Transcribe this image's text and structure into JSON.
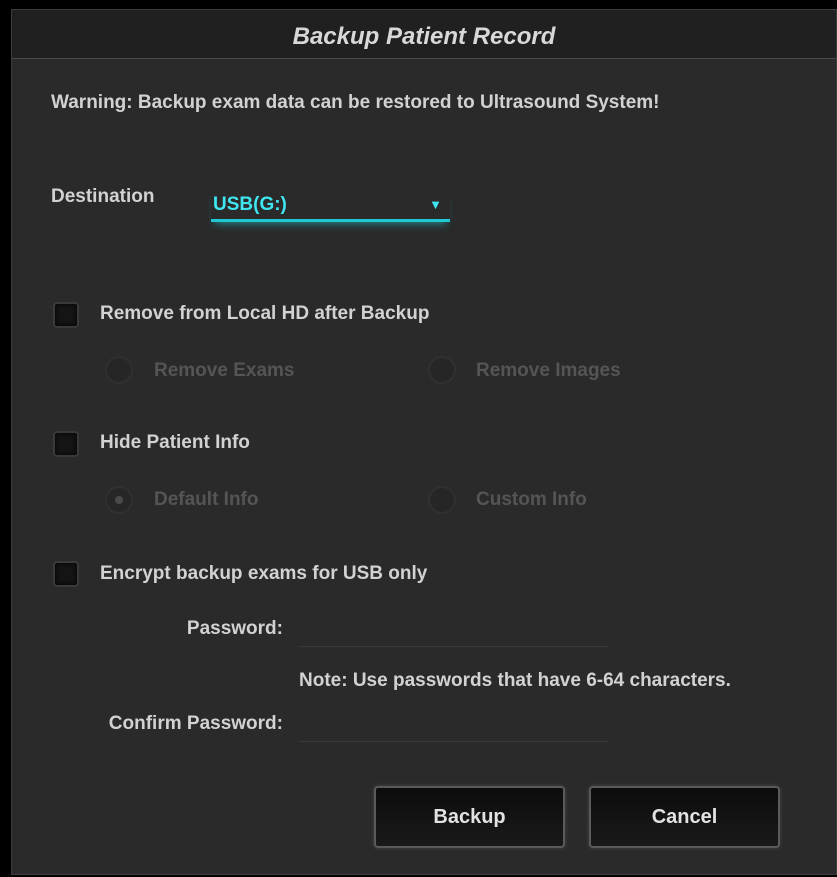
{
  "dialog": {
    "title": "Backup Patient Record",
    "warning": "Warning: Backup exam data can be restored to Ultrasound System!"
  },
  "destination": {
    "label": "Destination",
    "value": "USB(G:)",
    "arrow_glyph": "▼",
    "accent_color": "#3fe6f0"
  },
  "remove_local": {
    "label": "Remove from Local HD after Backup",
    "checked": false,
    "options": [
      {
        "label": "Remove Exams",
        "selected": false,
        "enabled": false
      },
      {
        "label": "Remove Images",
        "selected": false,
        "enabled": false
      }
    ]
  },
  "hide_patient": {
    "label": "Hide Patient Info",
    "checked": false,
    "options": [
      {
        "label": "Default Info",
        "selected": true,
        "enabled": false
      },
      {
        "label": "Custom Info",
        "selected": false,
        "enabled": false
      }
    ]
  },
  "encrypt": {
    "label": "Encrypt backup exams for USB only",
    "checked": false,
    "password_label": "Password:",
    "password_value": "",
    "note": "Note: Use passwords that have 6-64 characters.",
    "confirm_label": "Confirm Password:",
    "confirm_value": ""
  },
  "buttons": {
    "backup": "Backup",
    "cancel": "Cancel"
  }
}
